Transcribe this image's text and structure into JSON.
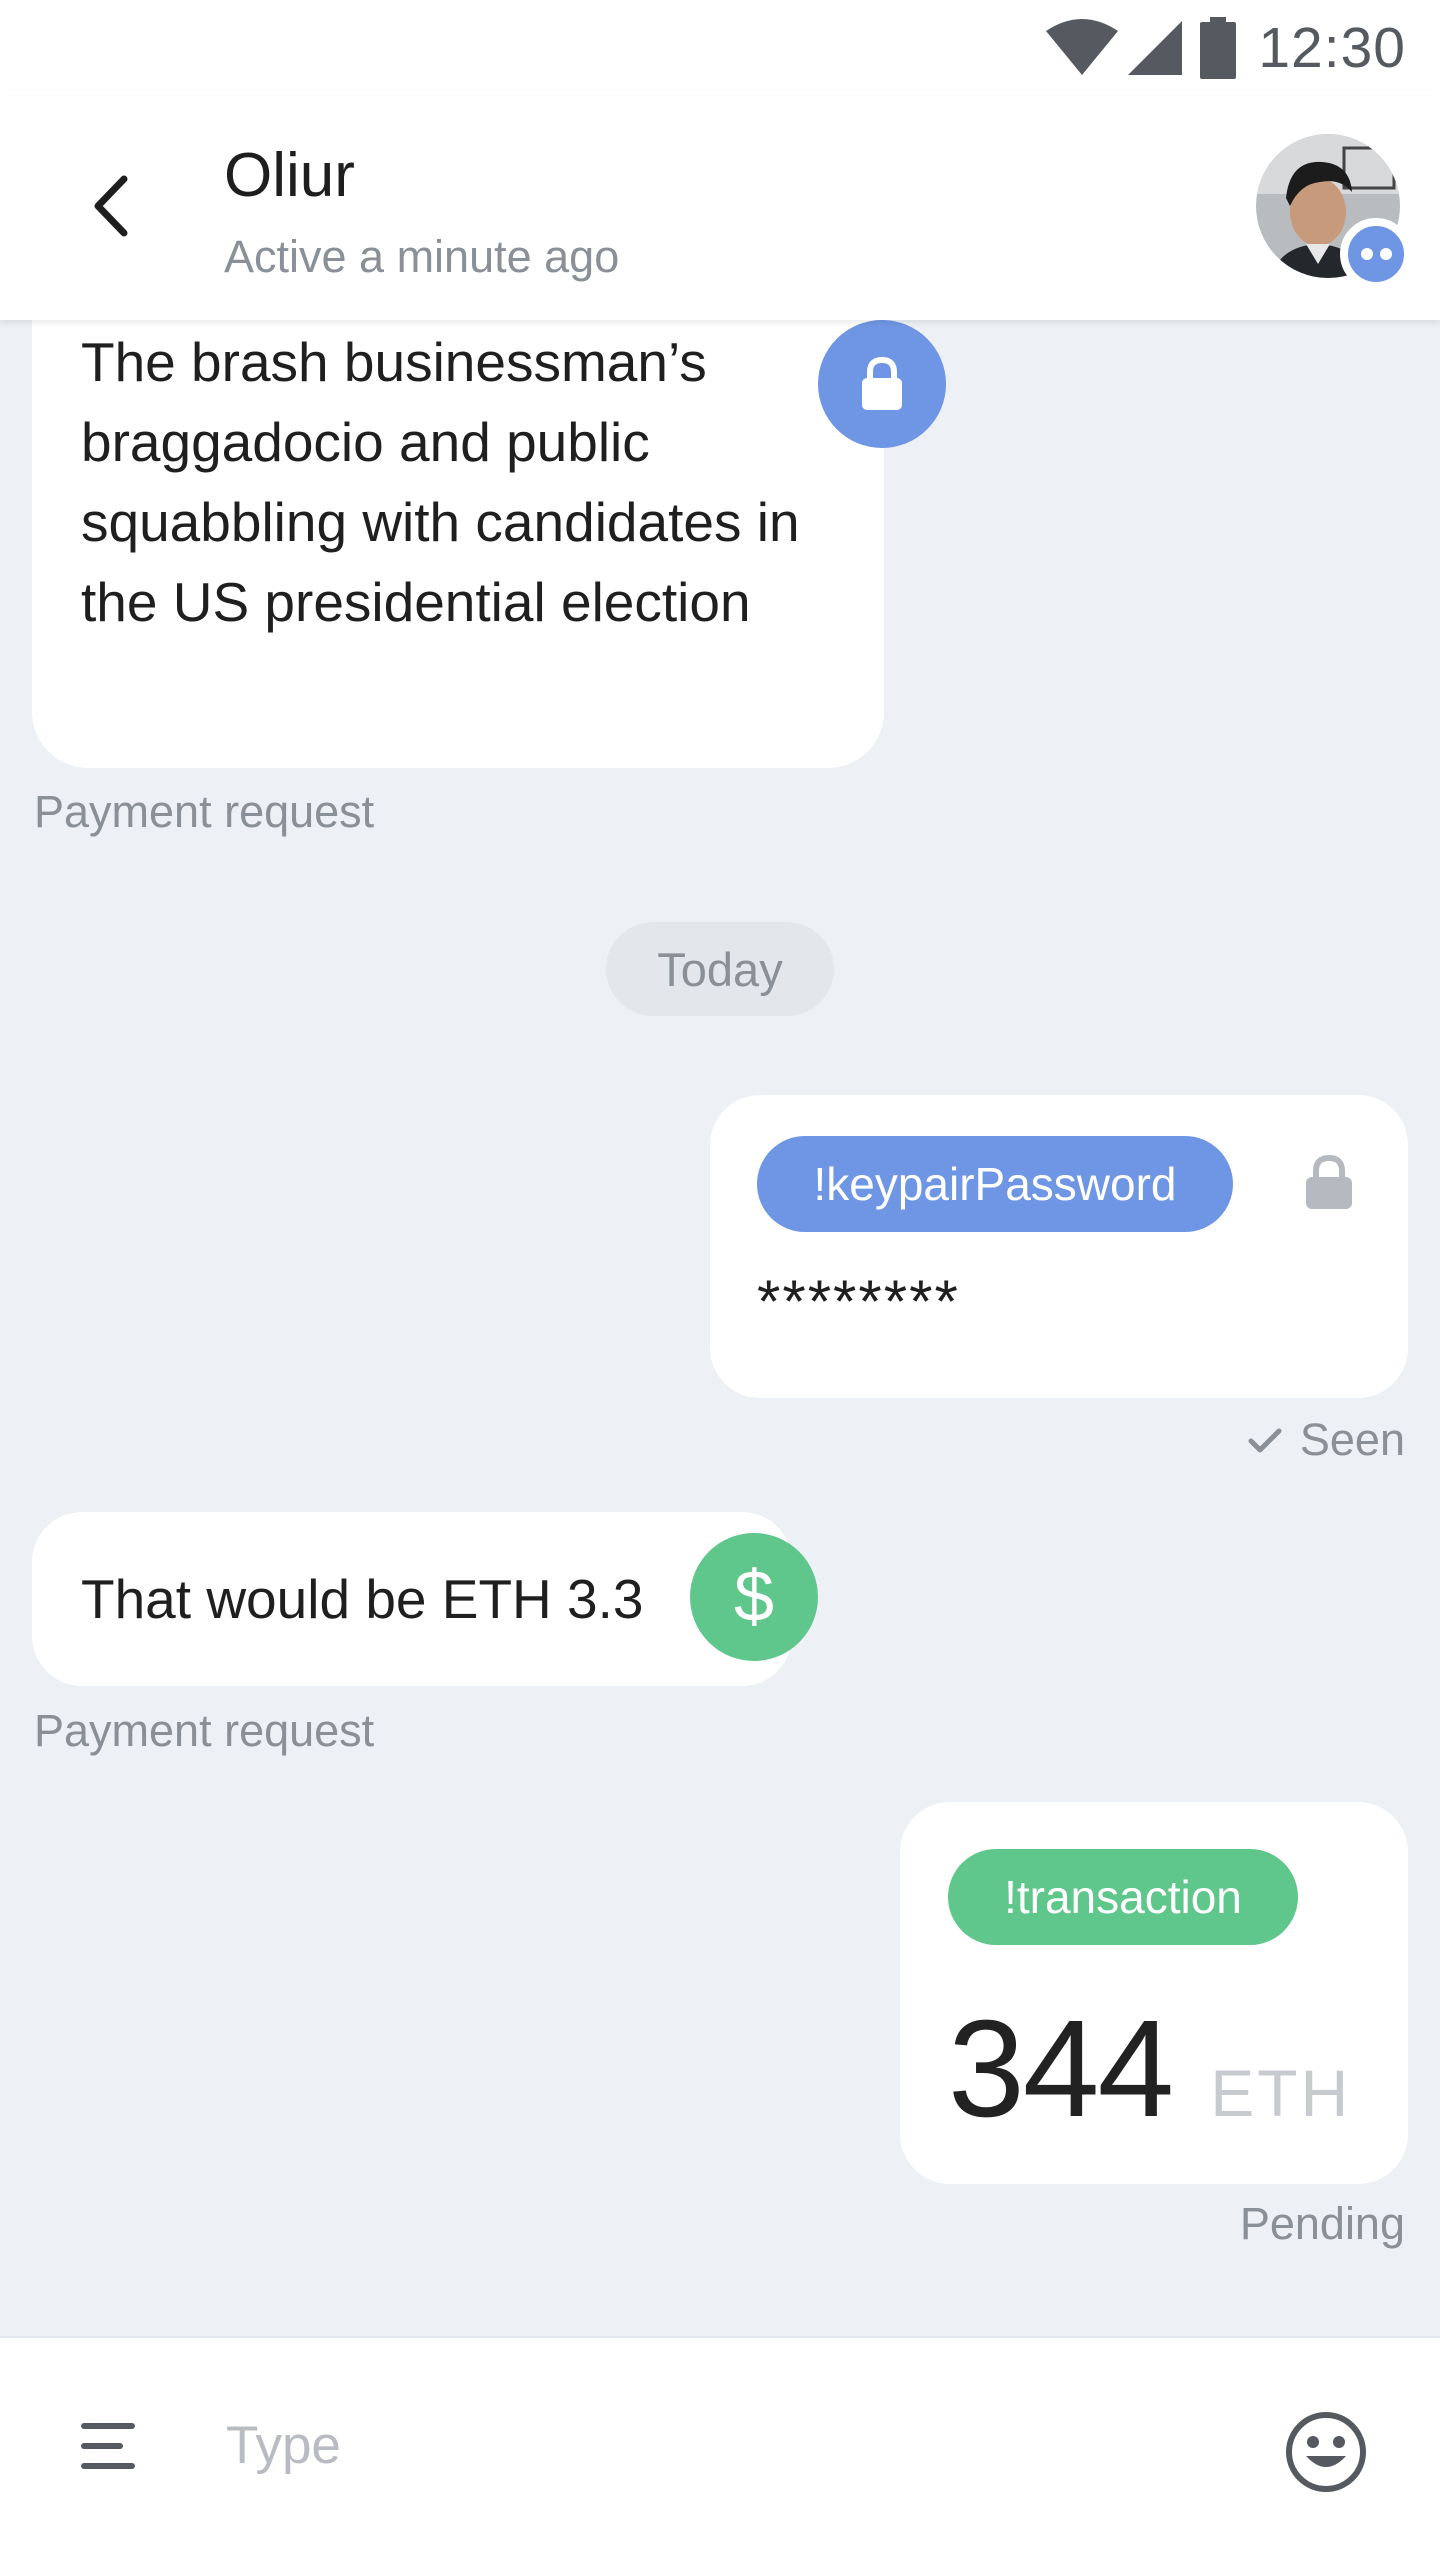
{
  "status_bar": {
    "time": "12:30",
    "icons": [
      "wifi-icon",
      "cellular-signal-icon",
      "battery-icon"
    ]
  },
  "header": {
    "back_icon": "chevron-left-icon",
    "contact_name": "Oliur",
    "contact_status": "Active a minute ago",
    "avatar_badge_icon": "more-dots-icon"
  },
  "messages": [
    {
      "direction": "incoming",
      "text": "The brash businessman’s braggadocio and public squabbling with candidates in the US presidential election",
      "icon": "lock-icon",
      "meta": "Payment request"
    },
    {
      "type": "date-separator",
      "label": "Today"
    },
    {
      "direction": "outgoing",
      "tag": "!keypairPassword",
      "text": "********",
      "icon": "lock-icon",
      "meta": "Seen"
    },
    {
      "direction": "incoming",
      "text": "That would be ETH 3.3",
      "icon": "dollar-icon",
      "icon_glyph": "$",
      "meta": "Payment request"
    },
    {
      "direction": "outgoing",
      "tag": "!transaction",
      "amount": "344",
      "unit": "ETH",
      "meta": "Pending"
    }
  ],
  "composer": {
    "placeholder": "Type",
    "menu_icon": "menu-lines-icon",
    "emoji_icon": "smiley-icon"
  },
  "colors": {
    "background": "#edf0f4",
    "accent_blue": "#6f96e4",
    "accent_green": "#5fc78c",
    "muted_text": "#8a9097"
  }
}
